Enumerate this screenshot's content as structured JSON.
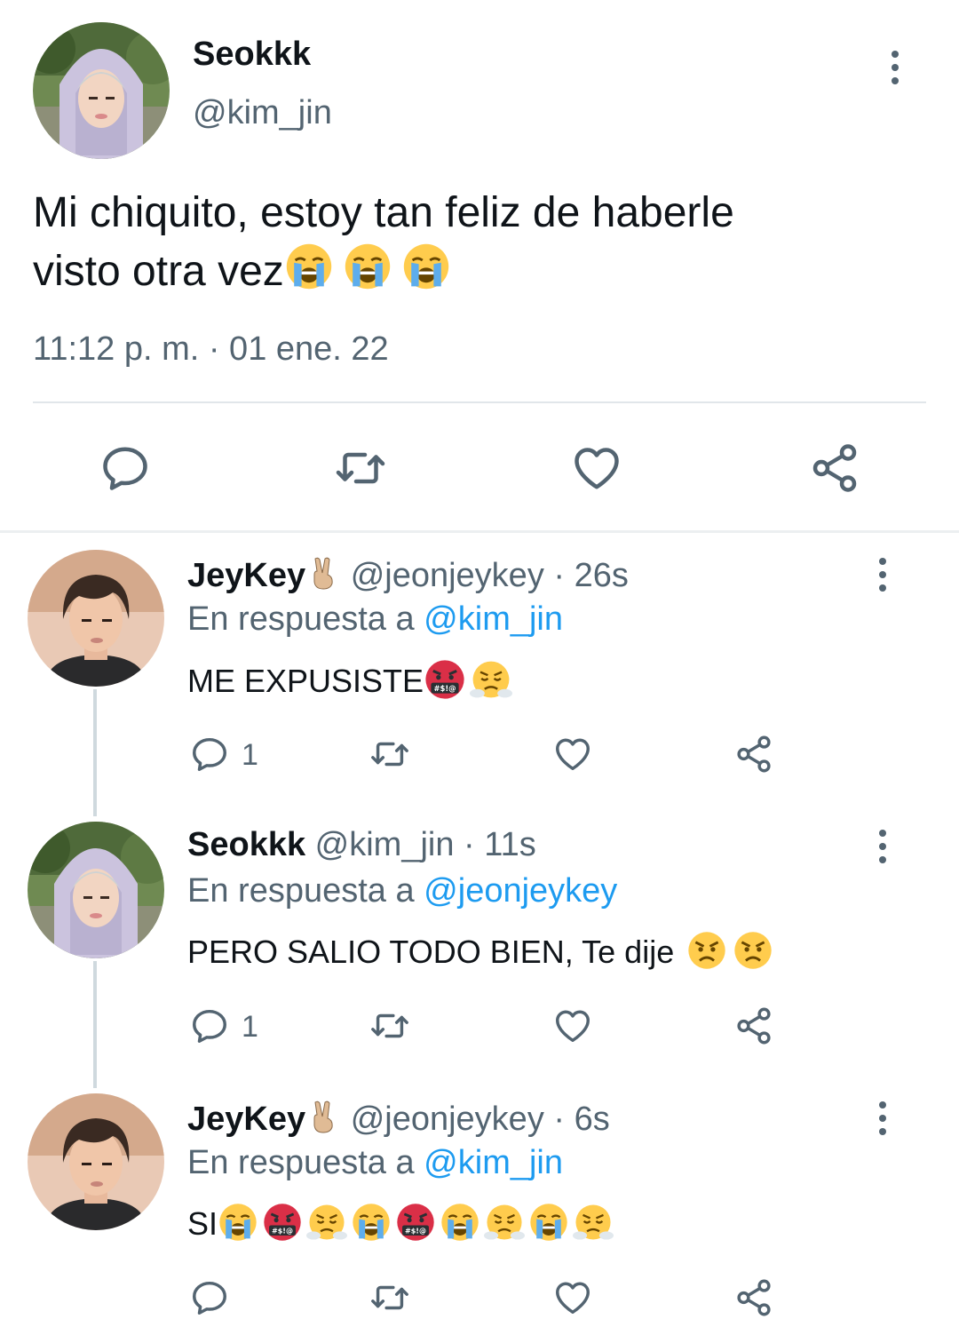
{
  "main_tweet": {
    "author_name": "Seokkk",
    "author_handle": "@kim_jin",
    "text_line1": "Mi chiquito, estoy tan feliz de haberle",
    "text_line2": "visto otra vez",
    "timestamp": "11:12 p. m. · 01 ene. 22",
    "emojis": [
      "loudly-crying-face",
      "loudly-crying-face",
      "loudly-crying-face"
    ],
    "actions": [
      "reply-icon",
      "retweet-icon",
      "like-icon",
      "share-icon"
    ]
  },
  "replies": [
    {
      "author_name": "JeyKey",
      "name_emoji": "victory-hand",
      "author_handle": "@jeonjeykey",
      "time": "· 26s",
      "in_reply_prefix": "En respuesta a",
      "in_reply_handle": "@kim_jin",
      "text": "ME EXPUSISTE",
      "emojis": [
        "face-with-symbols-on-mouth",
        "face-with-steam-from-nose"
      ],
      "reply_count": "1"
    },
    {
      "author_name": "Seokkk",
      "author_handle": "@kim_jin",
      "time": "· 11s",
      "in_reply_prefix": "En respuesta a",
      "in_reply_handle": "@jeonjeykey",
      "text": "PERO SALIO TODO BIEN, Te dije",
      "emojis": [
        "angry-face",
        "angry-face"
      ],
      "reply_count": "1"
    },
    {
      "author_name": "JeyKey",
      "name_emoji": "victory-hand",
      "author_handle": "@jeonjeykey",
      "time": "· 6s",
      "in_reply_prefix": "En respuesta a",
      "in_reply_handle": "@kim_jin",
      "text": "SI",
      "emojis": [
        "loudly-crying-face",
        "face-with-symbols-on-mouth",
        "face-with-steam-from-nose",
        "loudly-crying-face",
        "face-with-symbols-on-mouth",
        "loudly-crying-face",
        "face-with-steam-from-nose",
        "loudly-crying-face",
        "face-with-steam-from-nose"
      ],
      "reply_count": ""
    }
  ],
  "colors": {
    "text": "#0f1419",
    "secondary": "#536471",
    "link": "#1d9bf0",
    "divider": "#e1e6ea"
  }
}
